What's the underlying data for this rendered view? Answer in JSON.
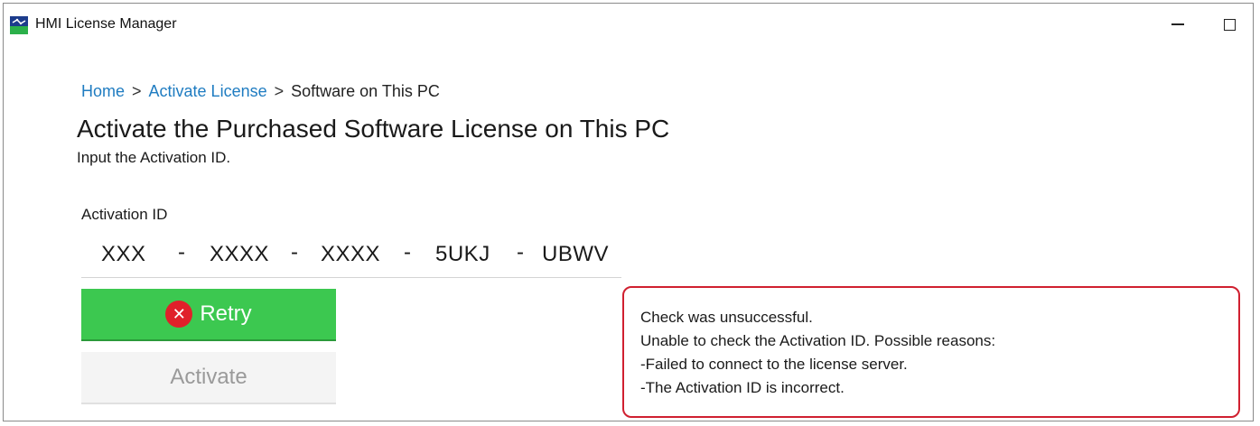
{
  "window": {
    "title": "HMI License Manager",
    "app_icon": "hmi-app-icon",
    "minimize_icon": "minimize-icon",
    "maximize_icon": "maximize-icon"
  },
  "breadcrumb": {
    "items": [
      "Home",
      "Activate License",
      "Software on This PC"
    ],
    "separator": ">"
  },
  "header": {
    "title": "Activate the Purchased Software License on This PC",
    "subtitle": "Input the Activation ID."
  },
  "activation": {
    "label": "Activation ID",
    "segments": [
      "XXX",
      "XXXX",
      "XXXX",
      "5UKJ",
      "UBWV"
    ],
    "separator": "-"
  },
  "buttons": {
    "retry": {
      "label": "Retry",
      "icon": "error-x-icon",
      "color": "#3cc850"
    },
    "activate": {
      "label": "Activate",
      "disabled": true
    }
  },
  "error": {
    "border_color": "#d02030",
    "lines": [
      "Check was unsuccessful.",
      "Unable to check the Activation ID. Possible reasons:",
      "-Failed to connect to the license server.",
      "-The Activation ID is incorrect."
    ]
  }
}
